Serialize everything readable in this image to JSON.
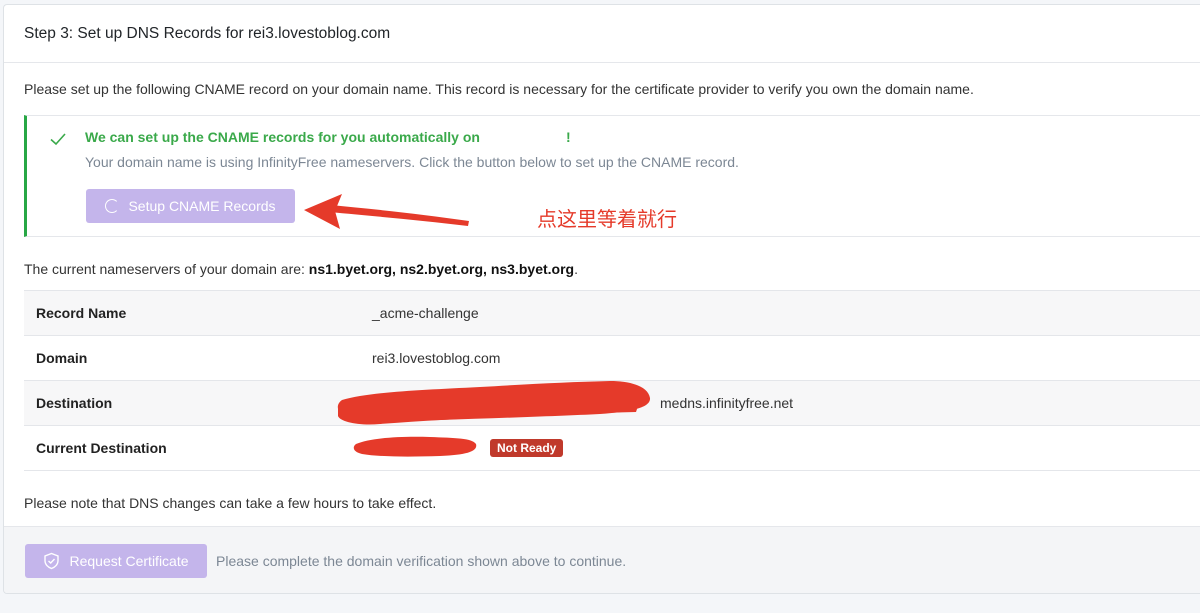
{
  "header": {
    "title": "Step 3: Set up DNS Records for rei3.lovestoblog.com"
  },
  "intro_text": "Please set up the following CNAME record on your domain name. This record is necessary for the certificate provider to verify you own the domain name.",
  "alert": {
    "title_prefix": "We can set up the CNAME records for you automatically on",
    "title_suffix": "!",
    "description": "Your domain name is using InfinityFree nameservers. Click the button below to set up the CNAME record.",
    "button_label": "Setup CNAME Records"
  },
  "nameservers": {
    "prefix": "The current nameservers of your domain are: ",
    "list": "ns1.byet.org, ns2.byet.org, ns3.byet.org",
    "suffix": "."
  },
  "records": [
    {
      "label": "Record Name",
      "value": "_acme-challenge"
    },
    {
      "label": "Domain",
      "value": "rei3.lovestoblog.com"
    },
    {
      "label": "Destination",
      "value": "medns.infinityfree.net"
    },
    {
      "label": "Current Destination",
      "badge": "Not Ready"
    }
  ],
  "note": "Please note that DNS changes can take a few hours to take effect.",
  "footer": {
    "button_label": "Request Certificate",
    "text": "Please complete the domain verification shown above to continue."
  },
  "annotation": {
    "text": "点这里等着就行"
  },
  "colors": {
    "success": "#3aa94a",
    "button_disabled": "#c4b5eb",
    "danger_badge": "#c0392b",
    "annotation_red": "#e53a2a"
  }
}
